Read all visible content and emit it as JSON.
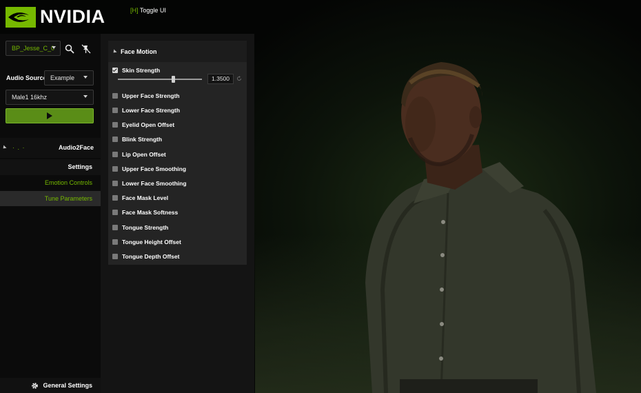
{
  "brand": {
    "logo_text": "NVIDIA",
    "accent_color": "#76b900"
  },
  "toggle_ui": {
    "key": "[H]",
    "label": "Toggle UI"
  },
  "sidebar": {
    "blueprint_select": {
      "value": "BP_Jesse_C_0"
    },
    "icons": [
      "search-icon",
      "pin-off-icon"
    ],
    "audio_source": {
      "label": "Audio Source",
      "value": "Example"
    },
    "audio_clip": {
      "value": "Male1 16khz"
    },
    "play_icon": "play-icon",
    "section": {
      "dots": "· . ·",
      "title": "Audio2Face"
    },
    "settings": {
      "label": "Settings"
    },
    "nav": [
      {
        "label": "Emotion Controls",
        "active": false
      },
      {
        "label": "Tune Parameters",
        "active": true
      }
    ],
    "general_settings": {
      "label": "General Settings",
      "icon": "gear-icon"
    }
  },
  "panel": {
    "title": "Face Motion",
    "params": [
      {
        "label": "Skin Strength",
        "checked": true,
        "value": "1.3500"
      },
      {
        "label": "Upper Face Strength",
        "checked": false
      },
      {
        "label": "Lower Face Strength",
        "checked": false
      },
      {
        "label": "Eyelid Open Offset",
        "checked": false
      },
      {
        "label": "Blink Strength",
        "checked": false
      },
      {
        "label": "Lip Open Offset",
        "checked": false
      },
      {
        "label": "Upper Face Smoothing",
        "checked": false
      },
      {
        "label": "Lower Face Smoothing",
        "checked": false
      },
      {
        "label": "Face Mask Level",
        "checked": false
      },
      {
        "label": "Face Mask Softness",
        "checked": false
      },
      {
        "label": "Tongue Strength",
        "checked": false
      },
      {
        "label": "Tongue Height Offset",
        "checked": false
      },
      {
        "label": "Tongue Depth Offset",
        "checked": false
      }
    ]
  }
}
